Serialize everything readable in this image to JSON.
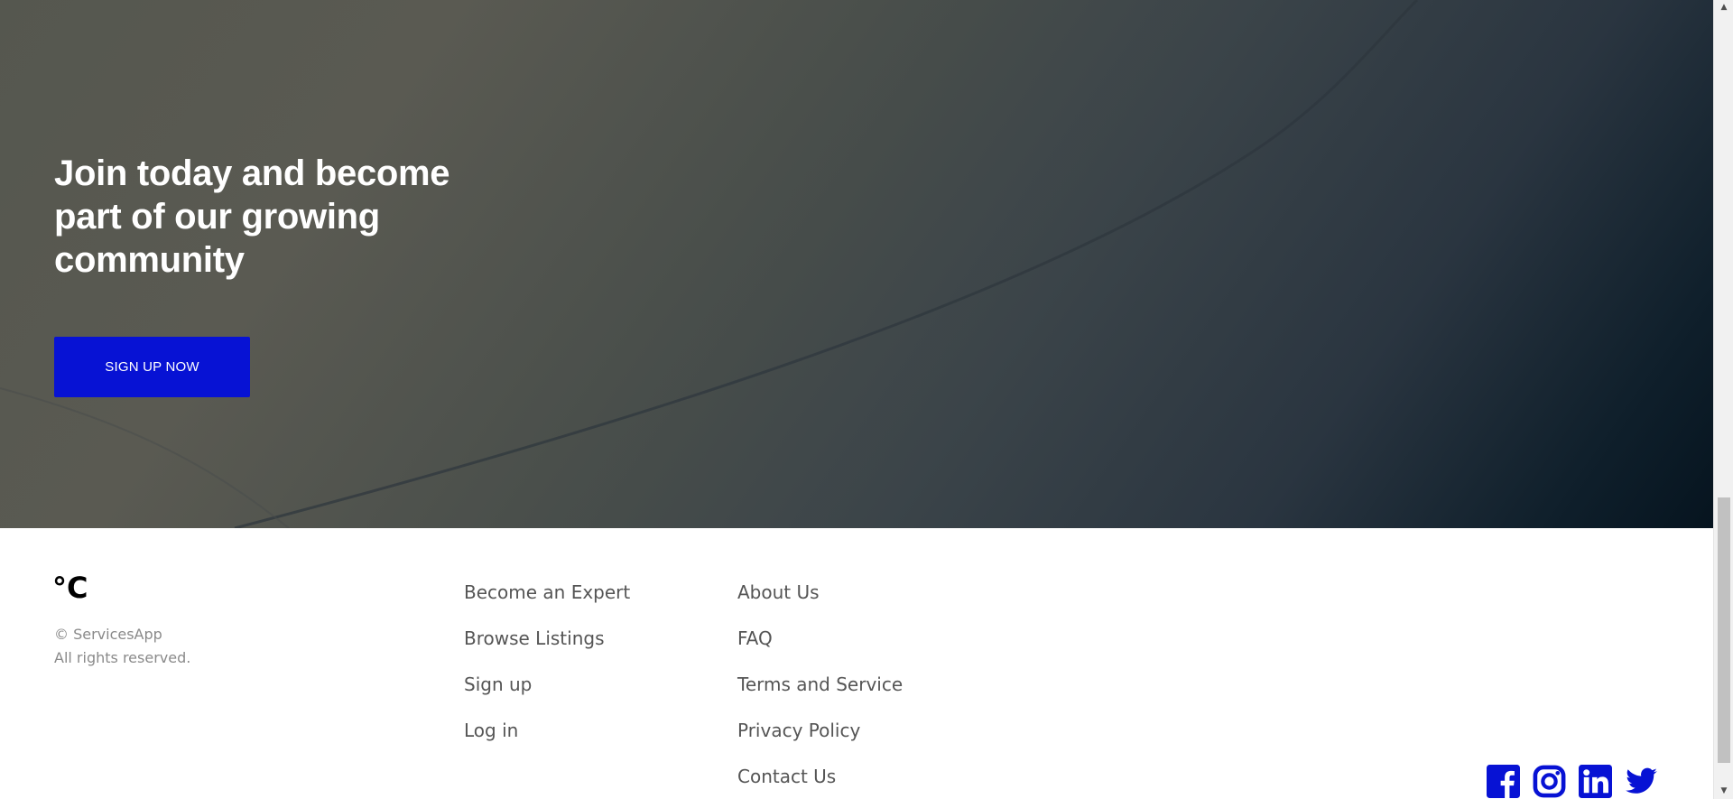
{
  "hero": {
    "title": "Join today and become part of our growing community",
    "cta_label": "SIGN UP NOW"
  },
  "footer": {
    "logo": "°C",
    "copyright_line1": "© ServicesApp",
    "copyright_line2": "All rights reserved.",
    "links_col1": [
      "Become an Expert",
      "Browse Listings",
      "Sign up",
      "Log in"
    ],
    "links_col2": [
      "About Us",
      "FAQ",
      "Terms and Service",
      "Privacy Policy",
      "Contact Us"
    ],
    "social": [
      "facebook-icon",
      "instagram-icon",
      "linkedin-icon",
      "twitter-icon"
    ]
  },
  "colors": {
    "accent": "#0712d4",
    "hero_overlay": "#3b4449",
    "link_text": "#555555",
    "muted_text": "#8a8a8a"
  }
}
